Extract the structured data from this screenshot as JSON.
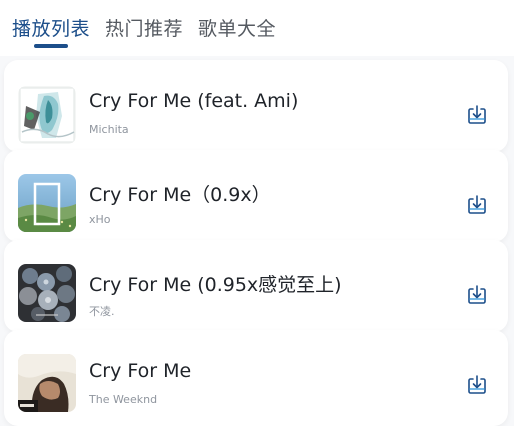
{
  "tabs": [
    {
      "label": "播放列表",
      "active": true
    },
    {
      "label": "热门推荐",
      "active": false
    },
    {
      "label": "歌单大全",
      "active": false
    }
  ],
  "colors": {
    "accent": "#1c4e8a",
    "tab_inactive": "#555a61",
    "title": "#1f2329",
    "subtitle": "#8f959e",
    "icon": "#1c4e8a",
    "background": "#f7f8fa"
  },
  "songs": [
    {
      "title": "Cry For Me (feat. Ami)",
      "artist": "Michita",
      "icon": "download-icon"
    },
    {
      "title": "Cry For Me（0.9x）",
      "artist": "xHo",
      "icon": "download-icon"
    },
    {
      "title": "Cry For Me (0.95x感觉至上)",
      "artist": "不凌.",
      "icon": "download-icon"
    },
    {
      "title": "Cry For Me",
      "artist": "The Weeknd",
      "icon": "download-icon"
    }
  ]
}
